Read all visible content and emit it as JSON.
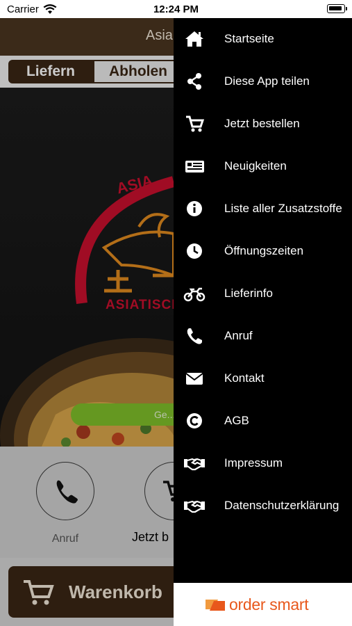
{
  "status_bar": {
    "carrier": "Carrier",
    "time": "12:24 PM"
  },
  "header": {
    "title": "Asia"
  },
  "tabs": [
    {
      "label": "Liefern",
      "selected": true
    },
    {
      "label": "Abholen",
      "selected": false
    }
  ],
  "hero": {
    "logo_text": "ASIATISCHE",
    "cta_label": "Ge..."
  },
  "actions": {
    "call_label": "Anruf",
    "order_label": "Jetzt b"
  },
  "cart": {
    "label": "Warenkorb"
  },
  "menu": {
    "items": [
      {
        "label": "Startseite",
        "icon": "home-icon"
      },
      {
        "label": "Diese App teilen",
        "icon": "share-icon"
      },
      {
        "label": "Jetzt bestellen",
        "icon": "cart-icon"
      },
      {
        "label": "Neuigkeiten",
        "icon": "news-icon"
      },
      {
        "label": "Liste aller Zusatzstoffe",
        "icon": "info-icon"
      },
      {
        "label": "Öffnungszeiten",
        "icon": "clock-icon"
      },
      {
        "label": "Lieferinfo",
        "icon": "motorcycle-icon"
      },
      {
        "label": "Anruf",
        "icon": "phone-icon"
      },
      {
        "label": "Kontakt",
        "icon": "envelope-icon"
      },
      {
        "label": "AGB",
        "icon": "copyright-icon"
      },
      {
        "label": "Impressum",
        "icon": "handshake-icon"
      },
      {
        "label": "Datenschutzerklärung",
        "icon": "handshake-icon"
      }
    ]
  },
  "brand": {
    "name": "order smart"
  },
  "colors": {
    "drawer_background": "#000000",
    "header_brown": "#4a3520",
    "tab_active": "#3a2614",
    "cta_green": "#7fbf2a",
    "brand_orange": "#e8581c",
    "logo_red": "#c8102e"
  }
}
